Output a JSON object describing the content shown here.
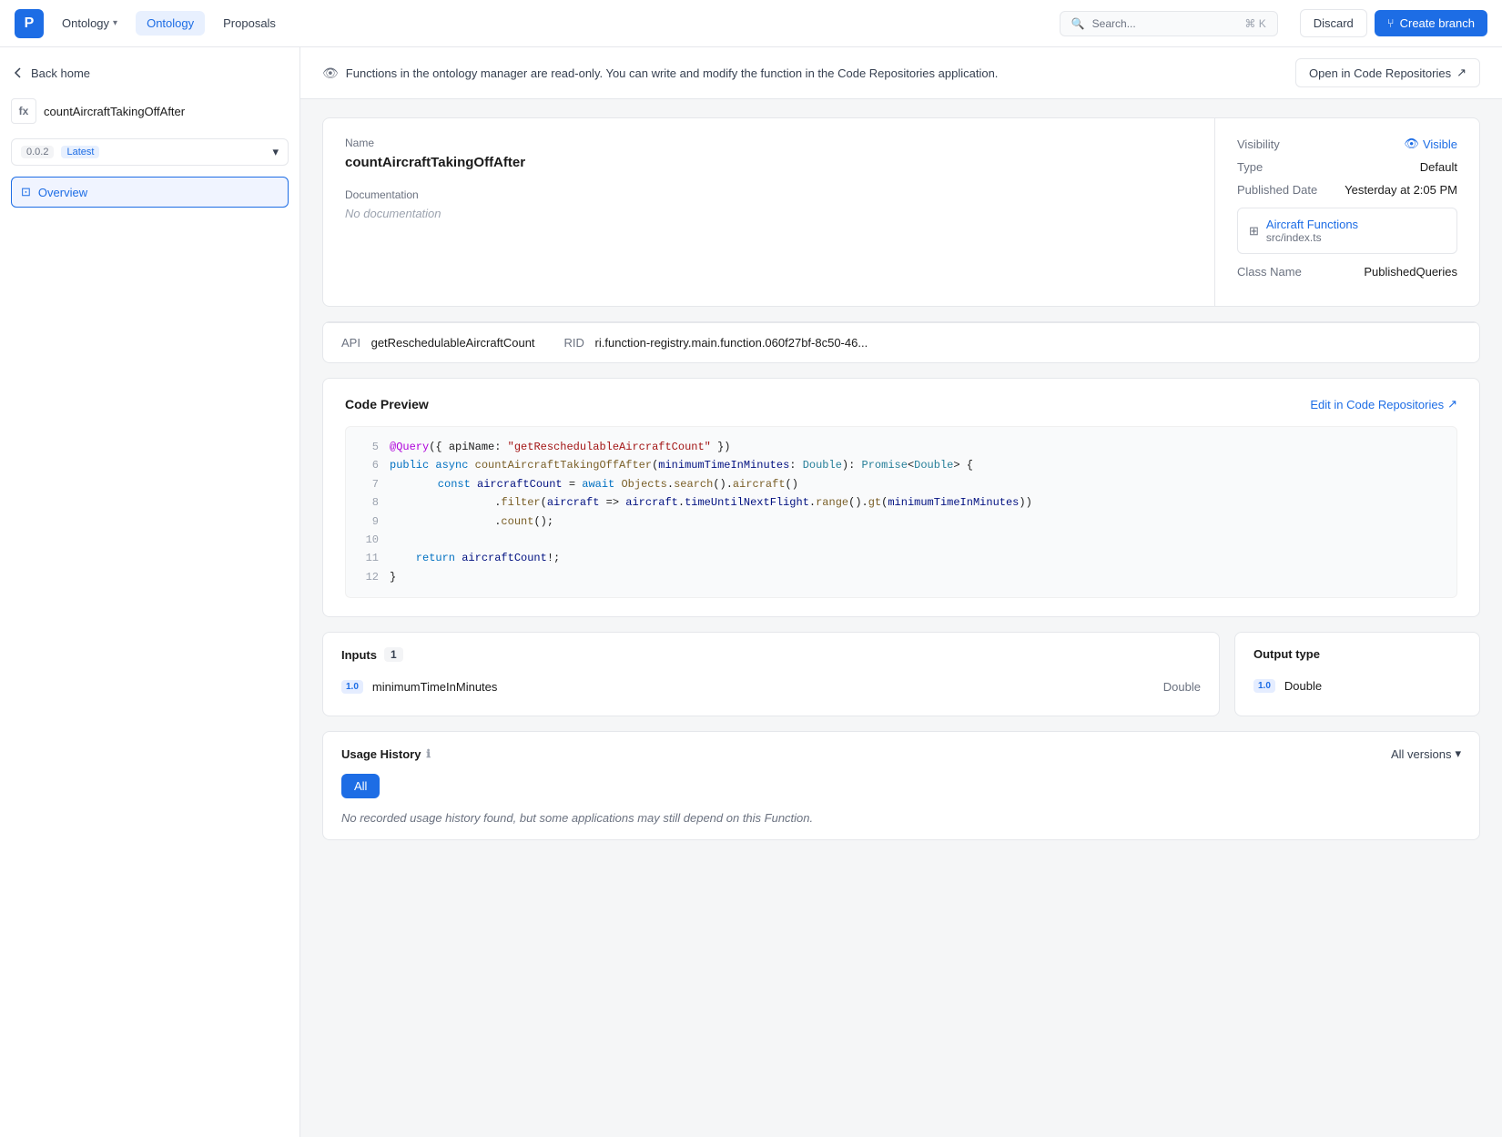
{
  "nav": {
    "logo": "P",
    "tabs": [
      {
        "label": "Ontology",
        "dropdown": true,
        "active": false
      },
      {
        "label": "Ontology",
        "dropdown": false,
        "active": true
      },
      {
        "label": "Proposals",
        "dropdown": false,
        "active": false
      }
    ],
    "search_placeholder": "Search...",
    "search_shortcut": "⌘ K",
    "discard_label": "Discard",
    "create_branch_label": "Create branch"
  },
  "sidebar": {
    "back_label": "Back home",
    "function_name": "countAircraftTakingOffAfter",
    "version": "0.0.2",
    "latest": "Latest",
    "overview_label": "Overview"
  },
  "banner": {
    "message": "Functions in the ontology manager are read-only. You can write and modify the function in the Code Repositories application.",
    "open_label": "Open in Code Repositories"
  },
  "meta": {
    "name_label": "Name",
    "name_value": "countAircraftTakingOffAfter",
    "doc_label": "Documentation",
    "doc_value": "No documentation",
    "visibility_label": "Visibility",
    "visibility_value": "Visible",
    "type_label": "Type",
    "type_value": "Default",
    "published_label": "Published Date",
    "published_value": "Yesterday at 2:05 PM",
    "repo_name": "Aircraft Functions",
    "repo_path": "src/index.ts",
    "class_name_label": "Class Name",
    "class_name_value": "PublishedQueries",
    "api_label": "API",
    "api_value": "getReschedulableAircraftCount",
    "rid_label": "RID",
    "rid_value": "ri.function-registry.main.function.060f27bf-8c50-46..."
  },
  "code_preview": {
    "title": "Code Preview",
    "edit_label": "Edit in Code Repositories",
    "lines": [
      {
        "num": "5",
        "content": "@Query({ apiName: \"getReschedulableAircraftCount\" })"
      },
      {
        "num": "6",
        "content": "public async countAircraftTakingOffAfter(minimumTimeInMinutes: Double): Promise<Double> {"
      },
      {
        "num": "7",
        "content": "    const aircraftCount = await Objects.search().aircraft()"
      },
      {
        "num": "8",
        "content": "                .filter(aircraft => aircraft.timeUntilNextFlight.range().gt(minimumTimeInMinutes))"
      },
      {
        "num": "9",
        "content": "                .count();"
      },
      {
        "num": "10",
        "content": ""
      },
      {
        "num": "11",
        "content": "    return aircraftCount!;"
      },
      {
        "num": "12",
        "content": "}"
      }
    ]
  },
  "inputs": {
    "title": "Inputs",
    "count": "1",
    "params": [
      {
        "version": "1.0",
        "name": "minimumTimeInMinutes",
        "type": "Double"
      }
    ]
  },
  "output": {
    "title": "Output type",
    "params": [
      {
        "version": "1.0",
        "name": "Double",
        "type": ""
      }
    ]
  },
  "usage": {
    "title": "Usage History",
    "all_versions_label": "All versions",
    "all_button_label": "All",
    "no_history": "No recorded usage history found, but some applications may still depend on this Function."
  }
}
